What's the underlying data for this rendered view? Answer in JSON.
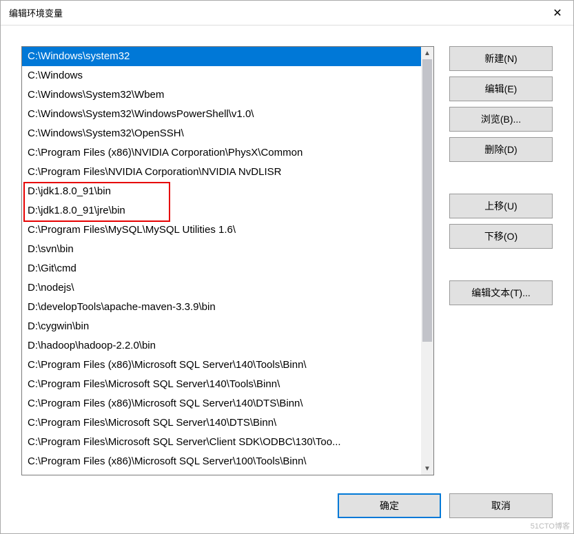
{
  "window": {
    "title": "编辑环境变量"
  },
  "list": {
    "items": [
      {
        "text": "C:\\Windows\\system32",
        "selected": true
      },
      {
        "text": "C:\\Windows",
        "selected": false
      },
      {
        "text": "C:\\Windows\\System32\\Wbem",
        "selected": false
      },
      {
        "text": "C:\\Windows\\System32\\WindowsPowerShell\\v1.0\\",
        "selected": false
      },
      {
        "text": "C:\\Windows\\System32\\OpenSSH\\",
        "selected": false
      },
      {
        "text": "C:\\Program Files (x86)\\NVIDIA Corporation\\PhysX\\Common",
        "selected": false
      },
      {
        "text": "C:\\Program Files\\NVIDIA Corporation\\NVIDIA NvDLISR",
        "selected": false
      },
      {
        "text": "D:\\jdk1.8.0_91\\bin",
        "selected": false
      },
      {
        "text": "D:\\jdk1.8.0_91\\jre\\bin",
        "selected": false
      },
      {
        "text": "C:\\Program Files\\MySQL\\MySQL Utilities 1.6\\",
        "selected": false
      },
      {
        "text": "D:\\svn\\bin",
        "selected": false
      },
      {
        "text": "D:\\Git\\cmd",
        "selected": false
      },
      {
        "text": "D:\\nodejs\\",
        "selected": false
      },
      {
        "text": "D:\\developTools\\apache-maven-3.3.9\\bin",
        "selected": false
      },
      {
        "text": "D:\\cygwin\\bin",
        "selected": false
      },
      {
        "text": "D:\\hadoop\\hadoop-2.2.0\\bin",
        "selected": false
      },
      {
        "text": "C:\\Program Files (x86)\\Microsoft SQL Server\\140\\Tools\\Binn\\",
        "selected": false
      },
      {
        "text": "C:\\Program Files\\Microsoft SQL Server\\140\\Tools\\Binn\\",
        "selected": false
      },
      {
        "text": "C:\\Program Files (x86)\\Microsoft SQL Server\\140\\DTS\\Binn\\",
        "selected": false
      },
      {
        "text": "C:\\Program Files\\Microsoft SQL Server\\140\\DTS\\Binn\\",
        "selected": false
      },
      {
        "text": "C:\\Program Files\\Microsoft SQL Server\\Client SDK\\ODBC\\130\\Too...",
        "selected": false
      },
      {
        "text": "C:\\Program Files (x86)\\Microsoft SQL Server\\100\\Tools\\Binn\\",
        "selected": false
      }
    ]
  },
  "buttons": {
    "new": "新建(N)",
    "edit": "编辑(E)",
    "browse": "浏览(B)...",
    "delete": "删除(D)",
    "moveUp": "上移(U)",
    "moveDown": "下移(O)",
    "editText": "编辑文本(T)...",
    "ok": "确定",
    "cancel": "取消"
  },
  "watermark": "51CTO博客"
}
